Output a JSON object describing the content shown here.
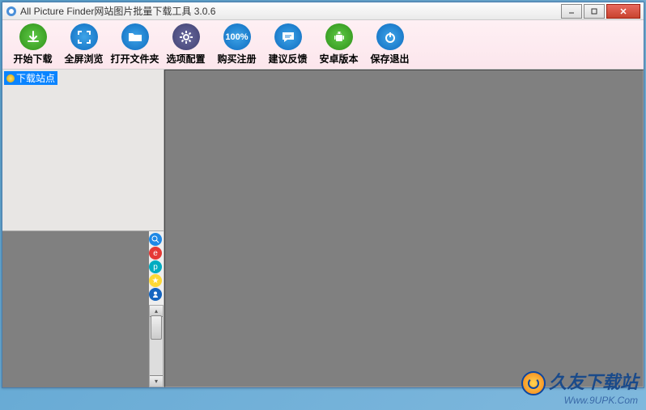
{
  "window": {
    "title": "All Picture Finder网站图片批量下载工具 3.0.6"
  },
  "toolbar": {
    "items": [
      {
        "label": "开始下载",
        "icon": "download",
        "color": "green"
      },
      {
        "label": "全屏浏览",
        "icon": "fullscreen",
        "color": "blue"
      },
      {
        "label": "打开文件夹",
        "icon": "folder",
        "color": "blue"
      },
      {
        "label": "选项配置",
        "icon": "gear",
        "color": "purple"
      },
      {
        "label": "购买注册",
        "icon": "percent",
        "color": "blue"
      },
      {
        "label": "建议反馈",
        "icon": "chat",
        "color": "blue"
      },
      {
        "label": "安卓版本",
        "icon": "android",
        "color": "green"
      },
      {
        "label": "保存退出",
        "icon": "power",
        "color": "blue"
      }
    ]
  },
  "tree": {
    "root": "下载站点"
  },
  "sidebar_icons": [
    "search",
    "weibo",
    "share",
    "favorite",
    "person"
  ],
  "watermark": {
    "main": "久友下载站",
    "sub": "Www.9UPK.Com"
  }
}
